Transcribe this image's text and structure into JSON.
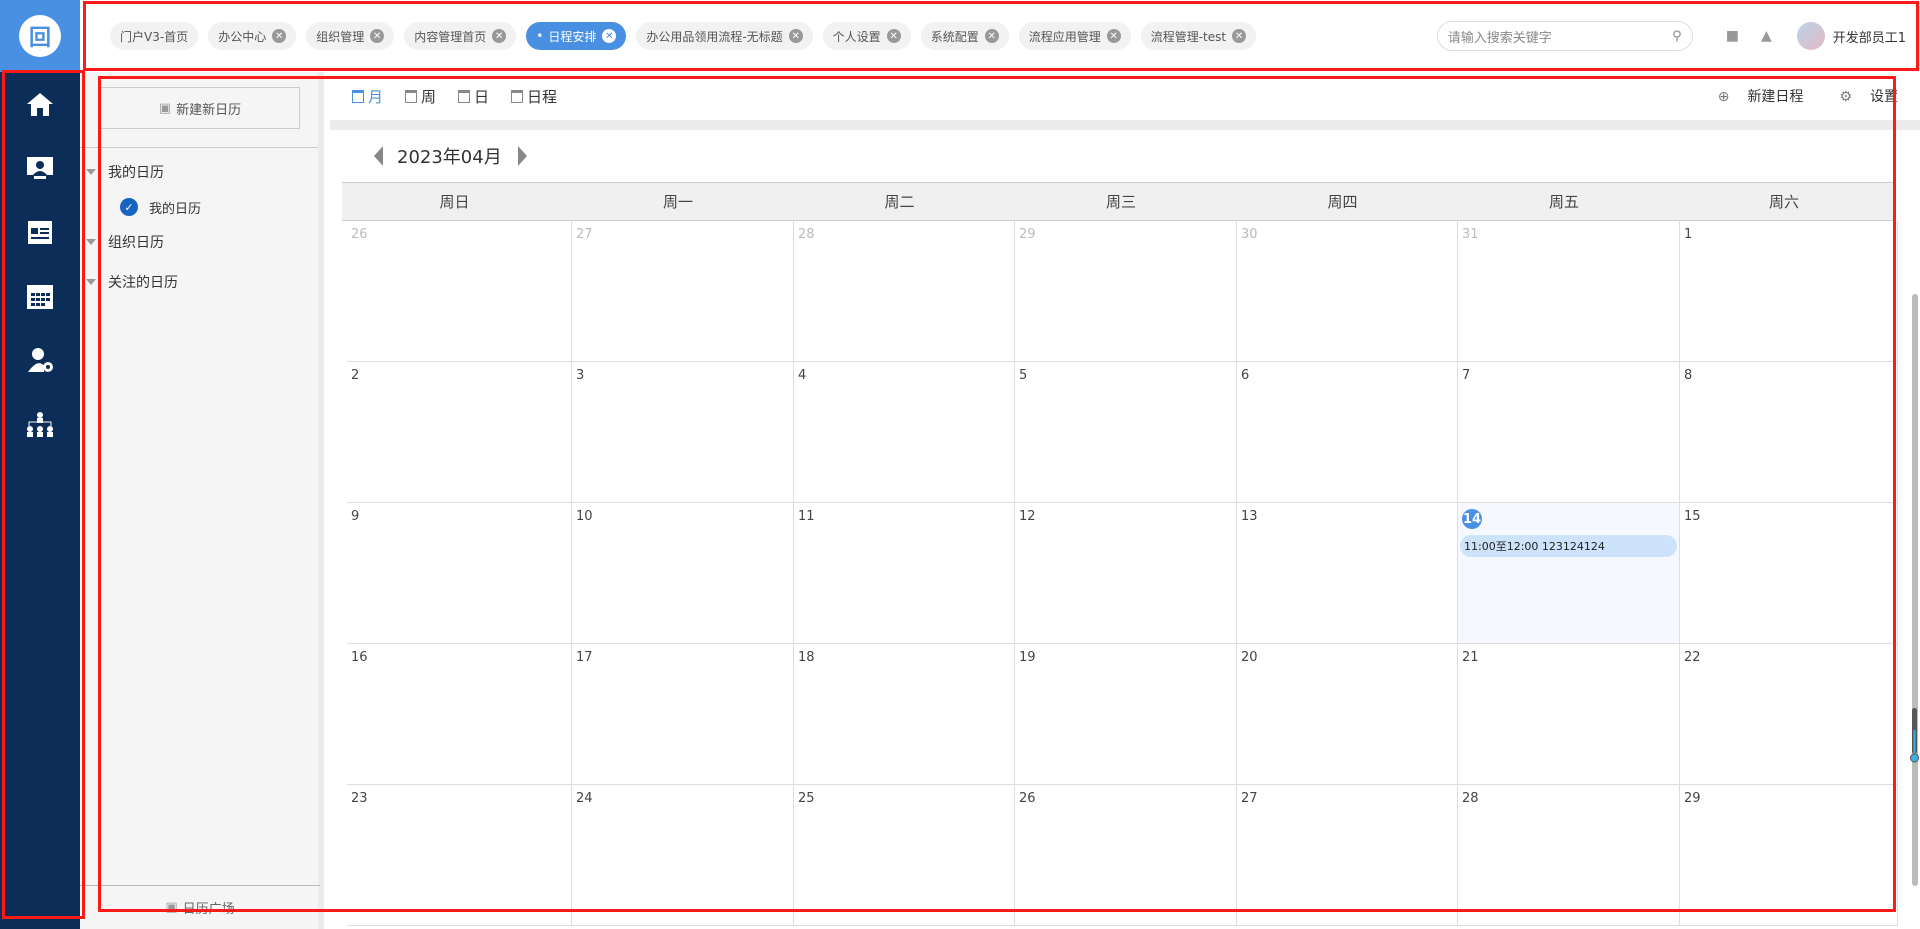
{
  "nav": {
    "logo": "回",
    "items": [
      {
        "icon": "home-icon"
      },
      {
        "icon": "desktop-user-icon"
      },
      {
        "icon": "news-icon"
      },
      {
        "icon": "calendar-icon"
      },
      {
        "icon": "user-settings-icon"
      },
      {
        "icon": "org-chart-icon"
      }
    ]
  },
  "tabs": [
    {
      "label": "门户V3-首页",
      "closable": false
    },
    {
      "label": "办公中心",
      "closable": true
    },
    {
      "label": "组织管理",
      "closable": true
    },
    {
      "label": "内容管理首页",
      "closable": true
    },
    {
      "label": "日程安排",
      "closable": true,
      "active": true
    },
    {
      "label": "办公用品领用流程-无标题",
      "closable": true
    },
    {
      "label": "个人设置",
      "closable": true
    },
    {
      "label": "系统配置",
      "closable": true
    },
    {
      "label": "流程应用管理",
      "closable": true
    },
    {
      "label": "流程管理-test",
      "closable": true
    }
  ],
  "search": {
    "placeholder": "请输入搜索关键字"
  },
  "user": {
    "name": "开发部员工1"
  },
  "sidebar": {
    "new_calendar": "新建新日历",
    "sections": [
      {
        "label": "我的日历",
        "items": [
          "我的日历"
        ]
      },
      {
        "label": "组织日历",
        "items": []
      },
      {
        "label": "关注的日历",
        "items": []
      }
    ],
    "square": "日历广场"
  },
  "toolbar": {
    "views": [
      "月",
      "周",
      "日",
      "日程"
    ],
    "active_view": "月",
    "new_event": "新建日程",
    "settings": "设置"
  },
  "calendar": {
    "month_label": "2023年04月",
    "weekdays": [
      "周日",
      "周一",
      "周二",
      "周三",
      "周四",
      "周五",
      "周六"
    ],
    "weeks": [
      [
        "26",
        "27",
        "28",
        "29",
        "30",
        "31",
        "1"
      ],
      [
        "2",
        "3",
        "4",
        "5",
        "6",
        "7",
        "8"
      ],
      [
        "9",
        "10",
        "11",
        "12",
        "13",
        "14",
        "15"
      ],
      [
        "16",
        "17",
        "18",
        "19",
        "20",
        "21",
        "22"
      ],
      [
        "23",
        "24",
        "25",
        "26",
        "27",
        "28",
        "29"
      ]
    ],
    "today": "14",
    "event": {
      "day": "14",
      "text": "11:00至12:00  123124124"
    }
  },
  "colors": {
    "nav": "#0b2d57",
    "accent": "#4a90e2",
    "event": "#cce3fb"
  }
}
